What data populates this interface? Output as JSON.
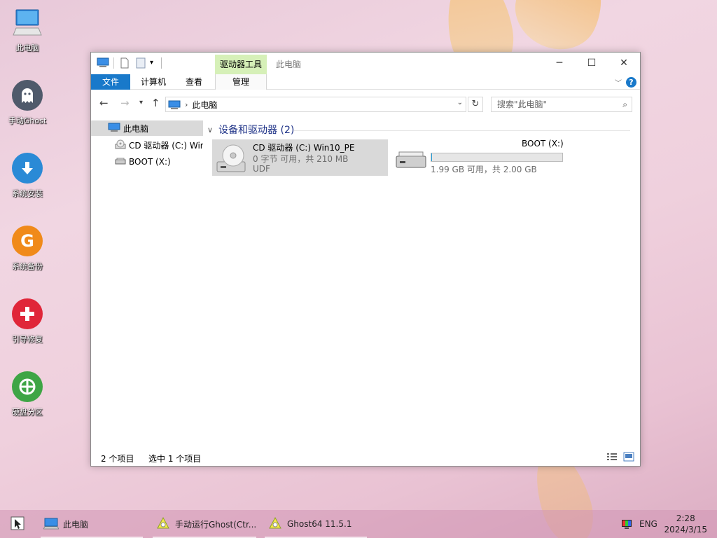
{
  "desktop": {
    "icons": [
      {
        "label": "此电脑",
        "icon": "computer-icon",
        "color": "#3a8ee6"
      },
      {
        "label": "手动Ghost",
        "icon": "ghost-icon",
        "color": "#4f5a6b"
      },
      {
        "label": "系统安装",
        "icon": "download-arrow-icon",
        "color": "#2a8ad6"
      },
      {
        "label": "系统备份",
        "icon": "backup-g-icon",
        "color": "#f08a1a"
      },
      {
        "label": "引导修复",
        "icon": "repair-plus-icon",
        "color": "#e02639"
      },
      {
        "label": "硬盘分区",
        "icon": "partition-icon",
        "color": "#3ea545"
      }
    ]
  },
  "window": {
    "title": "此电脑",
    "contextual_tab_group": "驱动器工具",
    "ribbon_tabs": {
      "file": "文件",
      "computer": "计算机",
      "view": "查看",
      "manage": "管理"
    },
    "controls": {
      "minimize": "─",
      "maximize": "☐",
      "close": "✕"
    },
    "help": "?",
    "address": {
      "path": "此电脑"
    },
    "search": {
      "placeholder": "搜索\"此电脑\""
    },
    "nav_pane": {
      "items": [
        {
          "label": "此电脑",
          "icon": "computer-icon",
          "selected": true
        },
        {
          "label": "CD 驱动器 (C:) Win",
          "icon": "cd-drive-icon",
          "selected": false
        },
        {
          "label": "BOOT (X:)",
          "icon": "drive-icon",
          "selected": false
        }
      ]
    },
    "group": {
      "header": "设备和驱动器 (2)"
    },
    "drives": [
      {
        "name": "CD 驱动器 (C:) Win10_PE",
        "line2": "0 字节 可用，共 210 MB",
        "line3": "UDF",
        "icon": "cd-drive-icon",
        "selected": true
      },
      {
        "name": "BOOT (X:)",
        "line2": "1.99 GB 可用，共 2.00 GB",
        "icon": "drive-icon",
        "used_fraction": 0.005,
        "selected": false
      }
    ],
    "status": {
      "count": "2 个项目",
      "selected": "选中 1 个项目"
    }
  },
  "taskbar": {
    "items": [
      {
        "label": "此电脑",
        "icon": "computer-icon"
      },
      {
        "label": "手动运行Ghost(Ctr...",
        "icon": "ghost-app-icon"
      },
      {
        "label": "Ghost64 11.5.1",
        "icon": "ghost-app-icon"
      }
    ],
    "lang": "ENG",
    "time": "2:28",
    "date": "2024/3/15"
  }
}
